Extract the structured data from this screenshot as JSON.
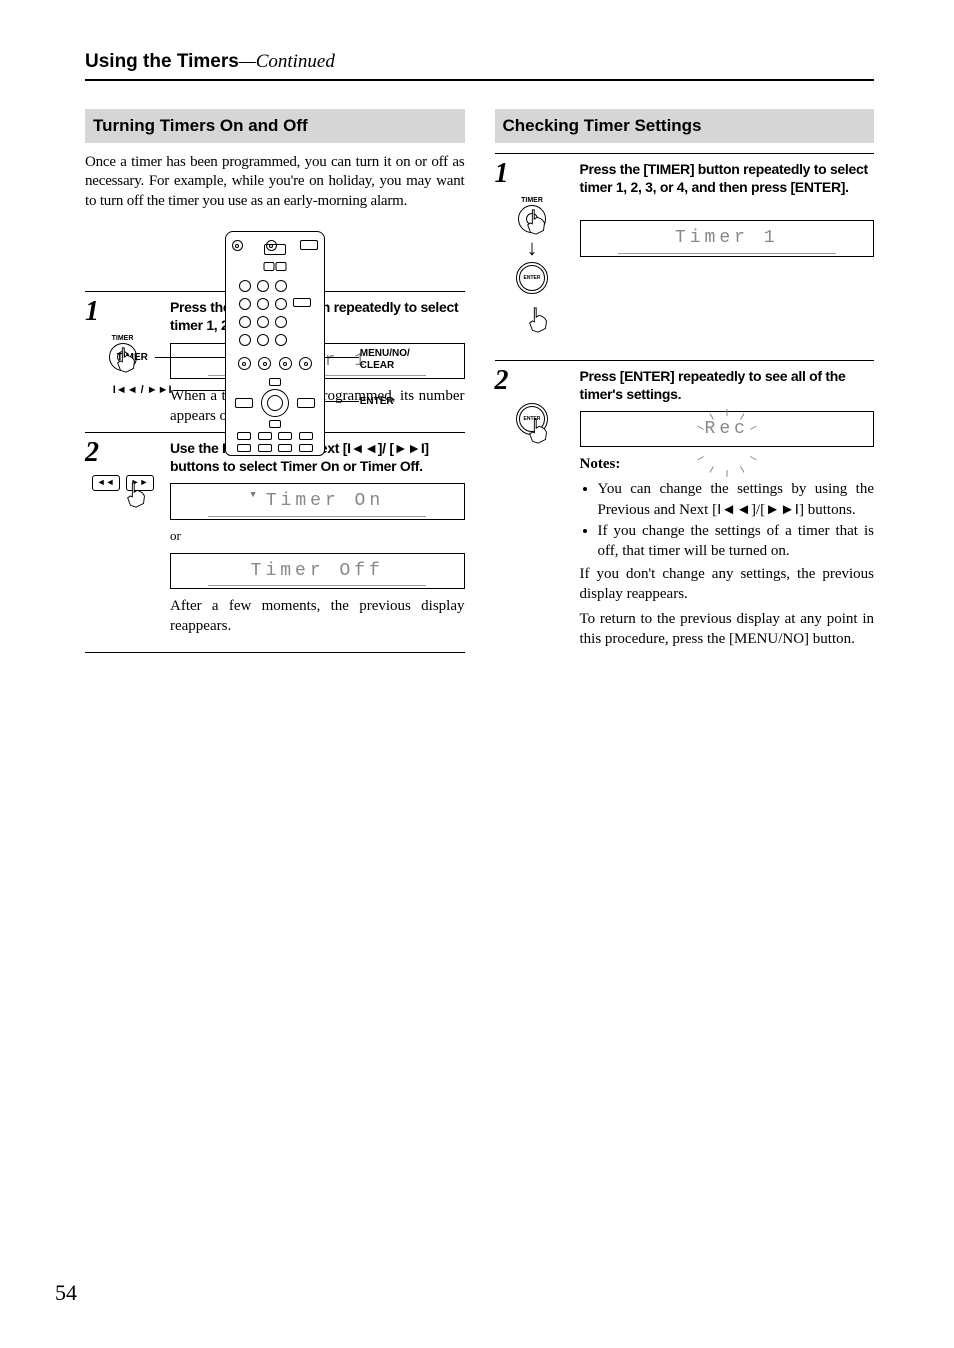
{
  "header": {
    "title": "Using the Timers",
    "continued": "—Continued"
  },
  "page_number": "54",
  "left": {
    "section_title": "Turning Timers On and Off",
    "intro": "Once a timer has been programmed, you can turn it on or off as necessary. For example, while you're on holiday, you may want to turn off the timer you use as an early-morning alarm.",
    "callouts": {
      "timer": "TIMER",
      "prevnext": "◄◄ / ►►",
      "menu": "MENU/NO/",
      "clear": "CLEAR",
      "enter": "ENTER"
    },
    "step1": {
      "num": "1",
      "label": "TIMER",
      "instr": "Press the [TIMER] button repeatedly to select timer 1, 2, 3, or 4.",
      "lcd": "Timer 1",
      "after": "When a timer has been programmed, its number appears on the display."
    },
    "step2": {
      "num": "2",
      "instr_a": "Use the Previous and Next [",
      "instr_b": "]/",
      "instr_c": "[",
      "instr_d": "] buttons to select Timer On or Timer Off.",
      "lcd_on": "Timer On",
      "or": "or",
      "lcd_off": "Timer Off",
      "after": "After a few moments, the previous display reappears."
    }
  },
  "right": {
    "section_title": "Checking Timer Settings",
    "step1": {
      "num": "1",
      "label": "TIMER",
      "enter_label": "ENTER",
      "instr": "Press the [TIMER] button repeatedly to select timer 1, 2, 3, or 4, and then press [ENTER].",
      "lcd": "Timer 1"
    },
    "step2": {
      "num": "2",
      "enter_label": "ENTER",
      "instr": "Press [ENTER] repeatedly to see all of the timer's settings.",
      "lcd": "Rec",
      "notes_h": "Notes:",
      "note1a": "You can change the settings by using the Previous and Next [",
      "note1b": "]/[",
      "note1c": "] buttons.",
      "note2": "If you change the settings of a timer that is off, that timer will be turned on.",
      "p1": "If you don't change any settings, the previous display reappears.",
      "p2": "To return to the previous display at any point in this procedure, press the [MENU/NO] button."
    }
  }
}
